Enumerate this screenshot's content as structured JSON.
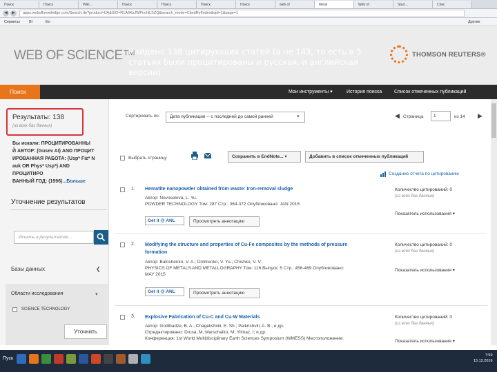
{
  "browser": {
    "tabs": [
      "Поиск",
      "Поиск",
      "Wiki…",
      "Поиск",
      "Поиск",
      "Поиск",
      "Поиск",
      "web of",
      "Metal",
      "Web of",
      "Stud…",
      "Спис"
    ],
    "active_tab_index": 8,
    "address": "apps.webofknowledge.com/Search.do?product=UA&SID=R1A6KsJWPnchlLSZQ&search_mode=CitedRefIndex&qid=1&page=1",
    "bookmarks": [
      "Сервисы",
      "Bl",
      "Eo"
    ],
    "bookmarks_right": "Другие закладки"
  },
  "header": {
    "logo": "WEB OF SCIENCE™",
    "overlay_text": "Найдено 138 цитирующих статей (а не 143, то есть в 5 статьях были процитированы и русская, и английская версии)",
    "brand": "THOMSON REUTERS®"
  },
  "nav": {
    "search": "Поиск",
    "my_tools": "Мои инструменты",
    "search_history": "История поиска",
    "marked_list": "Список отмеченных публикаций"
  },
  "sidebar": {
    "results_label": "Результаты: 138",
    "results_sub": "(из всех баз данных)",
    "query_lines": [
      "Вы искали: ПРОЦИТИРОВАННЫ",
      "Й АВТОР: (Gusev AI) AND ПРОЦИТ",
      "ИРОВАННАЯ РАБОТА: (Usp* Fiz* N",
      "auk OR Phys* Usp*) AND ПРОЦИТИРО",
      "ВАННЫЙ ГОД: (1996)"
    ],
    "query_more": "...Больше",
    "refine_title": "Уточнение результатов",
    "refine_placeholder": "Искать в результатах...",
    "databases": "Базы данных",
    "research_areas": "Области исследования",
    "area_option": "SCIENCE TECHNOLOGY",
    "clarify": "Уточнить"
  },
  "toolbar": {
    "sort_label": "Сортировать по:",
    "sort_value": "Дата публикации -- с последней до самой ранней",
    "page_label": "Страница",
    "page_value": "1",
    "page_of": "из 14",
    "select_page": "Выбрать страницу",
    "save_endnote": "Сохранить в EndNote...",
    "add_marked": "Добавить в список отмеченных публикаций",
    "citation_report": "Создание отчета по цитированию"
  },
  "records": [
    {
      "num": "1.",
      "title_lines": [
        "Hematite nanopowder obtained from waste: Iron-removal sludge"
      ],
      "lines": [
        "Автор: Novoselova, L. Yu.",
        "POWDER TECHNOLOGY  Том: 287  Стр.: 364-372  Опубликовано: JAN 2016"
      ],
      "cites": "Количество цитирований: 0",
      "cites_sub": "(из всех баз данных)",
      "usage": "Показатель использования"
    },
    {
      "num": "2.",
      "title_lines": [
        "Modifying the structure and properties of Cu-Fe composites by the methods of pressure",
        "formation"
      ],
      "lines": [
        "Автор: Baloshenko, V. A.; Dmitrenko, V. Yu.; Chishko, V. V.",
        "PHYSICS OF METALS AND METALLOGRAPHY  Том: 116  Выпуск: 5  Стр.: 456-469  Опубликовано:",
        "MAY 2015"
      ],
      "cites": "Количество цитирований: 0",
      "cites_sub": "(из всех баз данных)",
      "usage": "Показатель использования"
    },
    {
      "num": "3.",
      "title_lines": [
        "Explosive Fabrication of Cu-C and Cu-W Materials"
      ],
      "lines": [
        "Автор: Godibadze, B. A.; Chagelishvili, E. Sh.; Peikrishvili, A. B.; и др.",
        "Отредактировано: Drusa, M; Marschalko, M; Yilmaz, I; и др.",
        "Конференция: 1st World Multidisciplinary Earth Sciences Symposium (WMESS) Местоположение:"
      ],
      "cites": "Количество цитирований: 0",
      "cites_sub": "(из всех баз данных)",
      "usage": "Показатель использования"
    }
  ],
  "getit_label": "Get it @ ANL",
  "abstract_label": "Просмотреть аннотацию",
  "taskbar": {
    "start": "Пуск",
    "time": "7:59",
    "date": "15.12.2016"
  }
}
